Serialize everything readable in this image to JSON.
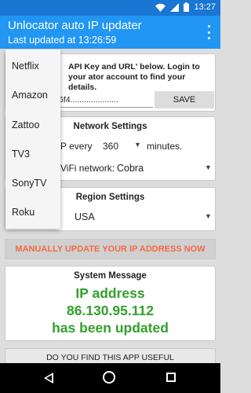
{
  "status_bar": {
    "time": "13:27"
  },
  "app_bar": {
    "title": "Unlocator auto IP updater",
    "subtitle": "Last updated at 13:26:59"
  },
  "api_card": {
    "instruction": "API Key and URL' below. Login to your ator account to find your details.",
    "api_value": "6f4.....................",
    "save_label": "SAVE"
  },
  "network_settings": {
    "heading": "Network Settings",
    "ip_every_label": "P every",
    "interval_value": "360",
    "minutes_label": "minutes.",
    "wifi_label": "ViFi network:",
    "wifi_value": "Cobra"
  },
  "region_settings": {
    "heading": "Region Settings",
    "region_value": "USA"
  },
  "update_button": "MANUALLY UPDATE YOUR IP ADDRESS NOW",
  "system_message": {
    "heading": "System Message",
    "line1": "IP address",
    "line2": "86.130.95.112",
    "line3": "has been updated"
  },
  "find_useful": "DO YOU FIND THIS APP USEFUL",
  "dropdown": {
    "items": [
      "Netflix",
      "Amazon",
      "Zattoo",
      "TV3",
      "SonyTV",
      "Roku"
    ]
  },
  "colors": {
    "app_bar": "#2196f3",
    "status_bar": "#1976d2",
    "accent_orange": "#f26b45",
    "message_green": "#33a02c"
  }
}
